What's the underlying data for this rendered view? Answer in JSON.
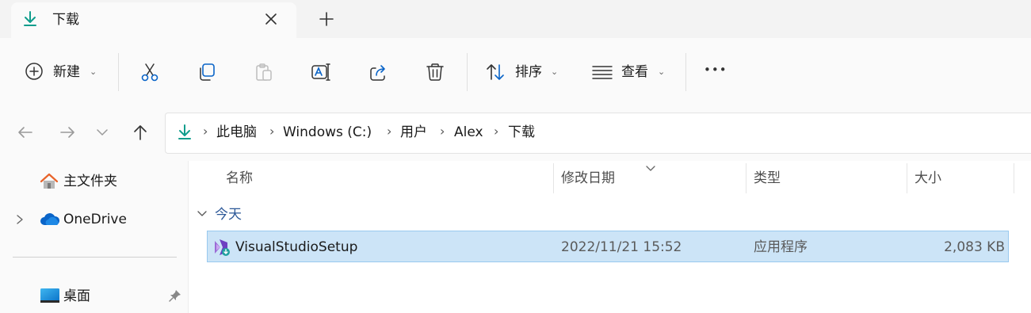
{
  "tab": {
    "title": "下载",
    "icon": "download-icon",
    "close_icon": "close-icon",
    "new_tab_label": "+"
  },
  "toolbar": {
    "new_label": "新建",
    "sort_label": "排序",
    "view_label": "查看",
    "more_label": "•••",
    "icons": [
      "cut-icon",
      "copy-icon",
      "paste-icon",
      "rename-icon",
      "share-icon",
      "delete-icon"
    ]
  },
  "nav_buttons": {
    "back_icon": "back-arrow-icon",
    "forward_icon": "forward-arrow-icon",
    "recent_icon": "chevron-down-icon",
    "up_icon": "up-arrow-icon"
  },
  "breadcrumb": [
    "此电脑",
    "Windows (C:)",
    "用户",
    "Alex",
    "下载"
  ],
  "sidebar": {
    "items": [
      {
        "label": "主文件夹",
        "icon": "home-icon"
      },
      {
        "label": "OneDrive",
        "icon": "cloud-icon"
      },
      {
        "label": "桌面",
        "icon": "desktop-icon",
        "pinned": true
      }
    ]
  },
  "columns": {
    "name": "名称",
    "date": "修改日期",
    "type": "类型",
    "size": "大小"
  },
  "group": {
    "label": "今天"
  },
  "files": [
    {
      "name": "VisualStudioSetup",
      "modified": "2022/11/21 15:52",
      "type": "应用程序",
      "size": "2,083 KB",
      "icon": "visual-studio-installer-icon",
      "selected": true
    }
  ],
  "colors": {
    "accent": "#0f9d8c",
    "selection": "#cce4f7",
    "selection_border": "#99c9ef",
    "onedrive": "#0a64c8",
    "home": "#e8632a"
  }
}
